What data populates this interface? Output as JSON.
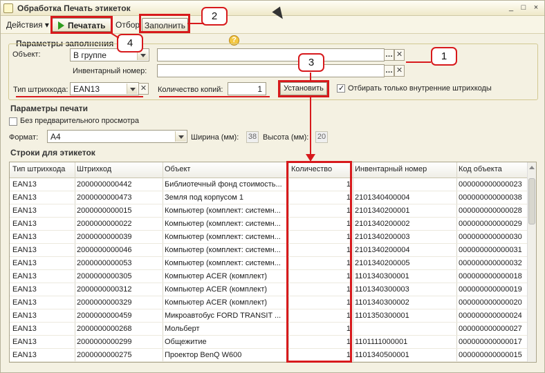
{
  "window": {
    "title": "Обработка  Печать этикеток",
    "btn_min": "_",
    "btn_max": "□",
    "btn_close": "×"
  },
  "toolbar": {
    "actions": "Действия ▾",
    "print": "Печатать",
    "filter": "Отбор",
    "fill": "Заполнить",
    "help": "?"
  },
  "fill_params": {
    "section_title": "Параметры заполнения",
    "object_label": "Объект:",
    "object_mode": "В группе",
    "object_value": "",
    "inventory_label": "Инвентарный номер:",
    "inventory_value": "",
    "barcode_type_label": "Тип штрихкода:",
    "barcode_type_value": "EAN13",
    "copies_label": "Количество копий:",
    "copies_value": "1",
    "set_button": "Установить",
    "internal_only_label": "Отбирать только внутренние штрихкоды",
    "internal_only_checked": true
  },
  "print_params": {
    "section_title": "Параметры печати",
    "no_preview_label": "Без предварительного просмотра",
    "format_label": "Формат:",
    "format_value": "A4",
    "width_label": "Ширина (мм):",
    "width_value": "38",
    "height_label": "Высота (мм):",
    "height_value": "20"
  },
  "rows_section": {
    "section_title": "Строки для этикеток",
    "columns": [
      "Тип штрихкода",
      "Штрихкод",
      "Объект",
      "Количество",
      "Инвентарный номер",
      "Код объекта"
    ],
    "rows": [
      [
        "EAN13",
        "2000000000442",
        "Библиотечный фонд стоимость...",
        "1",
        "",
        "000000000000023"
      ],
      [
        "EAN13",
        "2000000000473",
        "Земля под корпусом 1",
        "1",
        "2101340400004",
        "000000000000038"
      ],
      [
        "EAN13",
        "2000000000015",
        "Компьютер (комплект: системн...",
        "1",
        "2101340200001",
        "000000000000028"
      ],
      [
        "EAN13",
        "2000000000022",
        "Компьютер (комплект: системн...",
        "1",
        "2101340200002",
        "000000000000029"
      ],
      [
        "EAN13",
        "2000000000039",
        "Компьютер (комплект: системн...",
        "1",
        "2101340200003",
        "000000000000030"
      ],
      [
        "EAN13",
        "2000000000046",
        "Компьютер (комплект: системн...",
        "1",
        "2101340200004",
        "000000000000031"
      ],
      [
        "EAN13",
        "2000000000053",
        "Компьютер (комплект: системн...",
        "1",
        "2101340200005",
        "000000000000032"
      ],
      [
        "EAN13",
        "2000000000305",
        "Компьютер ACER (комплект)",
        "1",
        "1101340300001",
        "000000000000018"
      ],
      [
        "EAN13",
        "2000000000312",
        "Компьютер ACER (комплект)",
        "1",
        "1101340300003",
        "000000000000019"
      ],
      [
        "EAN13",
        "2000000000329",
        "Компьютер ACER (комплект)",
        "1",
        "1101340300002",
        "000000000000020"
      ],
      [
        "EAN13",
        "2000000000459",
        "Микроавтобус FORD TRANSIT ...",
        "1",
        "1101350300001",
        "000000000000024"
      ],
      [
        "EAN13",
        "2000000000268",
        "Мольберт",
        "1",
        "",
        "000000000000027"
      ],
      [
        "EAN13",
        "2000000000299",
        "Общежитие",
        "1",
        "1101111000001",
        "000000000000017"
      ],
      [
        "EAN13",
        "2000000000275",
        "Проектор BenQ W600",
        "1",
        "1101340500001",
        "000000000000015"
      ]
    ]
  },
  "annotations": {
    "n1": "1",
    "n2": "2",
    "n3": "3",
    "n4": "4"
  },
  "colors": {
    "annotation_red": "#d7191c",
    "print_green": "#2e9b1f"
  }
}
